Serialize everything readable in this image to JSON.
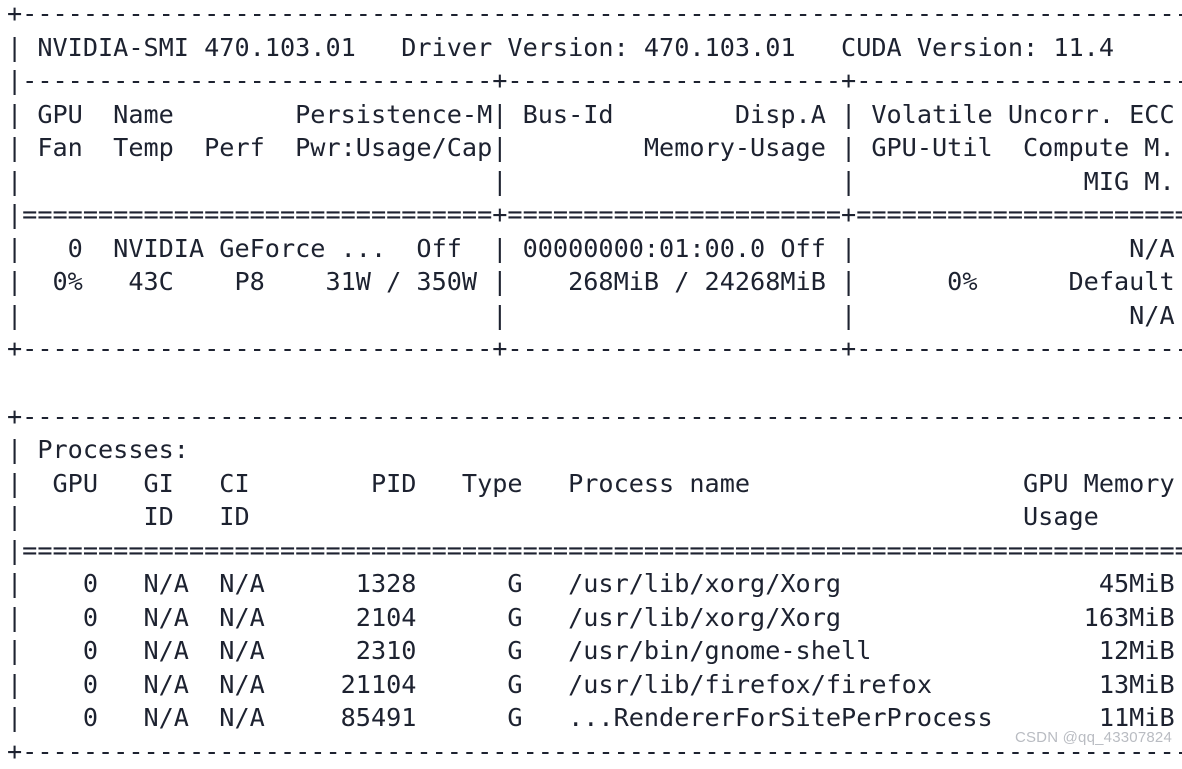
{
  "app": {
    "name": "nvidia-smi",
    "background_color": "#ffffff",
    "text_color": "#1d2230",
    "watermark_color": "#b9bcc2"
  },
  "header": {
    "smi_label": "NVIDIA-SMI",
    "smi_version": "470.103.01",
    "driver_label": "Driver Version:",
    "driver_version": "470.103.01",
    "cuda_label": "CUDA Version:",
    "cuda_version": "11.4"
  },
  "gpu_table": {
    "column_headers_row1": [
      "GPU",
      "Name",
      "Persistence-M",
      "Bus-Id",
      "Disp.A",
      "Volatile Uncorr. ECC"
    ],
    "column_headers_row2": [
      "Fan",
      "Temp",
      "Perf",
      "Pwr:Usage/Cap",
      "Memory-Usage",
      "GPU-Util",
      "Compute M."
    ],
    "column_headers_row3": [
      "MIG M."
    ],
    "rows": [
      {
        "gpu": "0",
        "name": "NVIDIA GeForce ...",
        "persistence_m": "Off",
        "bus_id": "00000000:01:00.0",
        "disp_a": "Off",
        "ecc": "N/A",
        "fan": "0%",
        "temp": "43C",
        "perf": "P8",
        "pwr_usage": "31W",
        "pwr_cap": "350W",
        "pwr_usage_cap": "31W / 350W",
        "memory_used": "268MiB",
        "memory_total": "24268MiB",
        "memory_usage": "268MiB / 24268MiB",
        "gpu_util": "0%",
        "compute_m": "Default",
        "mig_m": "N/A"
      }
    ]
  },
  "processes_table": {
    "title": "Processes:",
    "column_headers_row1": [
      "GPU",
      "GI",
      "CI",
      "PID",
      "Type",
      "Process name",
      "GPU Memory"
    ],
    "column_headers_row2": [
      "ID",
      "ID",
      "Usage"
    ],
    "rows": [
      {
        "gpu": "0",
        "gi_id": "N/A",
        "ci_id": "N/A",
        "pid": "1328",
        "type": "G",
        "process_name": "/usr/lib/xorg/Xorg",
        "gpu_memory_usage": "45MiB"
      },
      {
        "gpu": "0",
        "gi_id": "N/A",
        "ci_id": "N/A",
        "pid": "2104",
        "type": "G",
        "process_name": "/usr/lib/xorg/Xorg",
        "gpu_memory_usage": "163MiB"
      },
      {
        "gpu": "0",
        "gi_id": "N/A",
        "ci_id": "N/A",
        "pid": "2310",
        "type": "G",
        "process_name": "/usr/bin/gnome-shell",
        "gpu_memory_usage": "12MiB"
      },
      {
        "gpu": "0",
        "gi_id": "N/A",
        "ci_id": "N/A",
        "pid": "21104",
        "type": "G",
        "process_name": "/usr/lib/firefox/firefox",
        "gpu_memory_usage": "13MiB"
      },
      {
        "gpu": "0",
        "gi_id": "N/A",
        "ci_id": "N/A",
        "pid": "85491",
        "type": "G",
        "process_name": "...RendererForSitePerProcess",
        "gpu_memory_usage": "11MiB"
      }
    ]
  },
  "watermark": {
    "text": "CSDN @qq_43307824"
  },
  "rendered_text": "+-----------------------------------------------------------------------------+\n| NVIDIA-SMI 470.103.01   Driver Version: 470.103.01   CUDA Version: 11.4     |\n|-------------------------------+----------------------+----------------------+\n| GPU  Name        Persistence-M| Bus-Id        Disp.A | Volatile Uncorr. ECC |\n| Fan  Temp  Perf  Pwr:Usage/Cap|         Memory-Usage | GPU-Util  Compute M. |\n|                               |                      |               MIG M. |\n|===============================+======================+======================|\n|   0  NVIDIA GeForce ...  Off  | 00000000:01:00.0 Off |                  N/A |\n|  0%   43C    P8    31W / 350W |    268MiB / 24268MiB |      0%      Default |\n|                               |                      |                  N/A |\n+-------------------------------+----------------------+----------------------+\n                                                                               \n+-----------------------------------------------------------------------------+\n| Processes:                                                                  |\n|  GPU   GI   CI        PID   Type   Process name                  GPU Memory |\n|        ID   ID                                                   Usage      |\n|=============================================================================|\n|    0   N/A  N/A      1328      G   /usr/lib/xorg/Xorg                 45MiB |\n|    0   N/A  N/A      2104      G   /usr/lib/xorg/Xorg                163MiB |\n|    0   N/A  N/A      2310      G   /usr/bin/gnome-shell               12MiB |\n|    0   N/A  N/A     21104      G   /usr/lib/firefox/firefox           13MiB |\n|    0   N/A  N/A     85491      G   ...RendererForSitePerProcess       11MiB |\n+-----------------------------------------------------------------------------+"
}
